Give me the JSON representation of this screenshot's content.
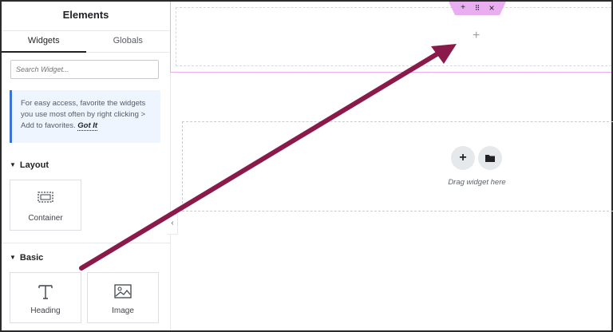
{
  "sidebar": {
    "title": "Elements",
    "tabs": [
      {
        "label": "Widgets",
        "active": true
      },
      {
        "label": "Globals",
        "active": false
      }
    ],
    "search": {
      "placeholder": "Search Widget..."
    },
    "tip": {
      "text": "For easy access, favorite the widgets you use most often by right clicking > Add to favorites.",
      "link": "Got It"
    },
    "categories": [
      {
        "label": "Layout",
        "widgets": [
          {
            "label": "Container",
            "icon": "container-icon"
          }
        ]
      },
      {
        "label": "Basic",
        "widgets": [
          {
            "label": "Heading",
            "icon": "heading-icon"
          },
          {
            "label": "Image",
            "icon": "image-icon"
          }
        ]
      }
    ],
    "collapse_glyph": "‹"
  },
  "canvas": {
    "handle": {
      "add": "+",
      "move": "⠿",
      "close": "×"
    },
    "top_section": {
      "add": "+"
    },
    "dropzone": {
      "add": "+",
      "text": "Drag widget here"
    }
  },
  "colors": {
    "accent_pink": "#e8aef0",
    "arrow": "#8a1a4a",
    "tip_border": "#3b72d6"
  }
}
